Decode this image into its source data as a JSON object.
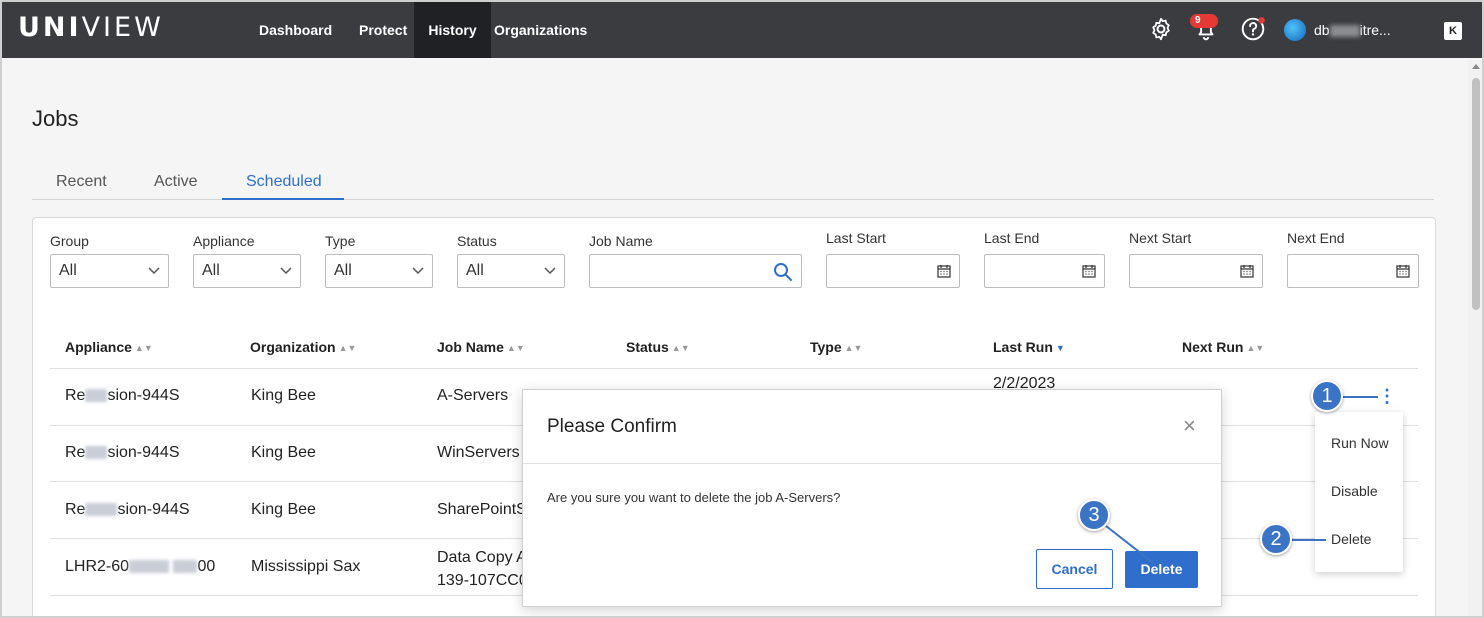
{
  "app": {
    "logo_bold": "UNI",
    "logo_thin": "VIEW"
  },
  "nav": {
    "items": [
      {
        "label": "Dashboard"
      },
      {
        "label": "Protect"
      },
      {
        "label": "History"
      },
      {
        "label": "Organizations"
      }
    ]
  },
  "topbar": {
    "notification_count": "9",
    "user_prefix": "db",
    "user_suffix": "itre...",
    "brand_mark": "K"
  },
  "page": {
    "title": "Jobs"
  },
  "tabs": [
    {
      "label": "Recent"
    },
    {
      "label": "Active"
    },
    {
      "label": "Scheduled"
    }
  ],
  "filters": {
    "group": {
      "label": "Group",
      "value": "All"
    },
    "appliance": {
      "label": "Appliance",
      "value": "All"
    },
    "type": {
      "label": "Type",
      "value": "All"
    },
    "status": {
      "label": "Status",
      "value": "All"
    },
    "job_name": {
      "label": "Job Name",
      "value": ""
    },
    "last_start": {
      "label": "Last Start"
    },
    "last_end": {
      "label": "Last End"
    },
    "next_start": {
      "label": "Next Start"
    },
    "next_end": {
      "label": "Next End"
    }
  },
  "table": {
    "headers": [
      "Appliance",
      "Organization",
      "Job Name",
      "Status",
      "Type",
      "Last Run",
      "Next Run"
    ],
    "rows": [
      {
        "appliance_a": "Re",
        "appliance_b": "sion-944S",
        "organization": "King Bee",
        "job_name": "A-Servers",
        "last_run": "2/2/2023"
      },
      {
        "appliance_a": "Re",
        "appliance_b": "sion-944S",
        "organization": "King Bee",
        "job_name": "WinServers"
      },
      {
        "appliance_a": "Re",
        "appliance_b": "sion-944S",
        "organization": "King Bee",
        "job_name": "SharePointS"
      },
      {
        "appliance_a": "LHR2-60",
        "appliance_b": "00",
        "organization": "Mississippi Sax",
        "job_name": "Data Copy A",
        "job_name_line2": "139-107CC0"
      }
    ]
  },
  "row_menu": {
    "items": [
      "Run Now",
      "Disable",
      "Delete"
    ]
  },
  "callouts": [
    "1",
    "2",
    "3"
  ],
  "dialog": {
    "title": "Please Confirm",
    "message": "Are you sure you want to delete the job A-Servers?",
    "cancel_label": "Cancel",
    "delete_label": "Delete",
    "close_glyph": "×"
  },
  "colors": {
    "accent": "#2f6fcb",
    "topbar": "#3a3c40",
    "callout": "#3b74c4",
    "badge": "#e53935"
  }
}
